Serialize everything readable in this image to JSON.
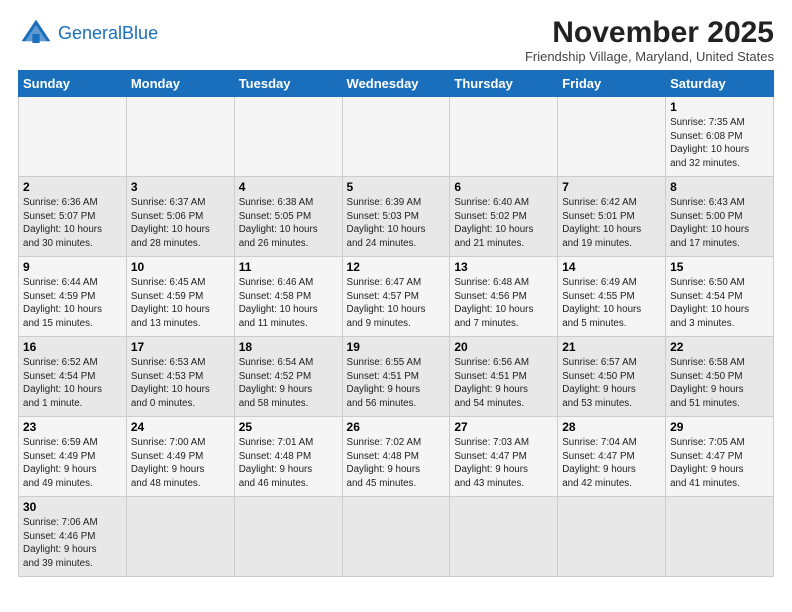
{
  "header": {
    "logo_general": "General",
    "logo_blue": "Blue",
    "month_title": "November 2025",
    "subtitle": "Friendship Village, Maryland, United States"
  },
  "weekdays": [
    "Sunday",
    "Monday",
    "Tuesday",
    "Wednesday",
    "Thursday",
    "Friday",
    "Saturday"
  ],
  "weeks": [
    [
      {
        "day": "",
        "info": ""
      },
      {
        "day": "",
        "info": ""
      },
      {
        "day": "",
        "info": ""
      },
      {
        "day": "",
        "info": ""
      },
      {
        "day": "",
        "info": ""
      },
      {
        "day": "",
        "info": ""
      },
      {
        "day": "1",
        "info": "Sunrise: 7:35 AM\nSunset: 6:08 PM\nDaylight: 10 hours\nand 32 minutes."
      }
    ],
    [
      {
        "day": "2",
        "info": "Sunrise: 6:36 AM\nSunset: 5:07 PM\nDaylight: 10 hours\nand 30 minutes."
      },
      {
        "day": "3",
        "info": "Sunrise: 6:37 AM\nSunset: 5:06 PM\nDaylight: 10 hours\nand 28 minutes."
      },
      {
        "day": "4",
        "info": "Sunrise: 6:38 AM\nSunset: 5:05 PM\nDaylight: 10 hours\nand 26 minutes."
      },
      {
        "day": "5",
        "info": "Sunrise: 6:39 AM\nSunset: 5:03 PM\nDaylight: 10 hours\nand 24 minutes."
      },
      {
        "day": "6",
        "info": "Sunrise: 6:40 AM\nSunset: 5:02 PM\nDaylight: 10 hours\nand 21 minutes."
      },
      {
        "day": "7",
        "info": "Sunrise: 6:42 AM\nSunset: 5:01 PM\nDaylight: 10 hours\nand 19 minutes."
      },
      {
        "day": "8",
        "info": "Sunrise: 6:43 AM\nSunset: 5:00 PM\nDaylight: 10 hours\nand 17 minutes."
      }
    ],
    [
      {
        "day": "9",
        "info": "Sunrise: 6:44 AM\nSunset: 4:59 PM\nDaylight: 10 hours\nand 15 minutes."
      },
      {
        "day": "10",
        "info": "Sunrise: 6:45 AM\nSunset: 4:59 PM\nDaylight: 10 hours\nand 13 minutes."
      },
      {
        "day": "11",
        "info": "Sunrise: 6:46 AM\nSunset: 4:58 PM\nDaylight: 10 hours\nand 11 minutes."
      },
      {
        "day": "12",
        "info": "Sunrise: 6:47 AM\nSunset: 4:57 PM\nDaylight: 10 hours\nand 9 minutes."
      },
      {
        "day": "13",
        "info": "Sunrise: 6:48 AM\nSunset: 4:56 PM\nDaylight: 10 hours\nand 7 minutes."
      },
      {
        "day": "14",
        "info": "Sunrise: 6:49 AM\nSunset: 4:55 PM\nDaylight: 10 hours\nand 5 minutes."
      },
      {
        "day": "15",
        "info": "Sunrise: 6:50 AM\nSunset: 4:54 PM\nDaylight: 10 hours\nand 3 minutes."
      }
    ],
    [
      {
        "day": "16",
        "info": "Sunrise: 6:52 AM\nSunset: 4:54 PM\nDaylight: 10 hours\nand 1 minute."
      },
      {
        "day": "17",
        "info": "Sunrise: 6:53 AM\nSunset: 4:53 PM\nDaylight: 10 hours\nand 0 minutes."
      },
      {
        "day": "18",
        "info": "Sunrise: 6:54 AM\nSunset: 4:52 PM\nDaylight: 9 hours\nand 58 minutes."
      },
      {
        "day": "19",
        "info": "Sunrise: 6:55 AM\nSunset: 4:51 PM\nDaylight: 9 hours\nand 56 minutes."
      },
      {
        "day": "20",
        "info": "Sunrise: 6:56 AM\nSunset: 4:51 PM\nDaylight: 9 hours\nand 54 minutes."
      },
      {
        "day": "21",
        "info": "Sunrise: 6:57 AM\nSunset: 4:50 PM\nDaylight: 9 hours\nand 53 minutes."
      },
      {
        "day": "22",
        "info": "Sunrise: 6:58 AM\nSunset: 4:50 PM\nDaylight: 9 hours\nand 51 minutes."
      }
    ],
    [
      {
        "day": "23",
        "info": "Sunrise: 6:59 AM\nSunset: 4:49 PM\nDaylight: 9 hours\nand 49 minutes."
      },
      {
        "day": "24",
        "info": "Sunrise: 7:00 AM\nSunset: 4:49 PM\nDaylight: 9 hours\nand 48 minutes."
      },
      {
        "day": "25",
        "info": "Sunrise: 7:01 AM\nSunset: 4:48 PM\nDaylight: 9 hours\nand 46 minutes."
      },
      {
        "day": "26",
        "info": "Sunrise: 7:02 AM\nSunset: 4:48 PM\nDaylight: 9 hours\nand 45 minutes."
      },
      {
        "day": "27",
        "info": "Sunrise: 7:03 AM\nSunset: 4:47 PM\nDaylight: 9 hours\nand 43 minutes."
      },
      {
        "day": "28",
        "info": "Sunrise: 7:04 AM\nSunset: 4:47 PM\nDaylight: 9 hours\nand 42 minutes."
      },
      {
        "day": "29",
        "info": "Sunrise: 7:05 AM\nSunset: 4:47 PM\nDaylight: 9 hours\nand 41 minutes."
      }
    ],
    [
      {
        "day": "30",
        "info": "Sunrise: 7:06 AM\nSunset: 4:46 PM\nDaylight: 9 hours\nand 39 minutes."
      },
      {
        "day": "",
        "info": ""
      },
      {
        "day": "",
        "info": ""
      },
      {
        "day": "",
        "info": ""
      },
      {
        "day": "",
        "info": ""
      },
      {
        "day": "",
        "info": ""
      },
      {
        "day": "",
        "info": ""
      }
    ]
  ]
}
